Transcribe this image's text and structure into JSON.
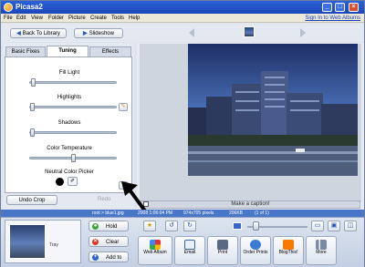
{
  "window": {
    "title": "Picasa2"
  },
  "menu": [
    "File",
    "Edit",
    "View",
    "Folder",
    "Picture",
    "Create",
    "Tools",
    "Help"
  ],
  "sign_in_link": "Sign In to Web Albums",
  "top_buttons": {
    "back": "Back To Library",
    "slideshow": "Slideshow"
  },
  "tabs": [
    {
      "label": "Basic Fixes",
      "active": false
    },
    {
      "label": "Tuning",
      "active": true
    },
    {
      "label": "Effects",
      "active": false
    }
  ],
  "tuning": {
    "fill_light": {
      "label": "Fill Light",
      "level": 0.03
    },
    "highlights": {
      "label": "Highlights",
      "level": 0.02
    },
    "shadows": {
      "label": "Shadows",
      "level": 0.02
    },
    "color_temperature": {
      "label": "Color Temperature",
      "level": 0.5
    },
    "neutral_picker": {
      "label": "Neutral Color Picker"
    }
  },
  "undo_label": "Undo Crop",
  "redo_label": "Redo",
  "caption_placeholder": "Make a caption!",
  "status": {
    "path": "root > blue1.jpg",
    "date": "2008 1:06:04 PM",
    "size": "974x705 pixels",
    "filesize": "206KB",
    "count": "(1 of 1)"
  },
  "tray": {
    "label": "Tray",
    "hold": "Hold",
    "clear": "Clear",
    "add_to": "Add to"
  },
  "actions": [
    "Web Album",
    "Email",
    "Print",
    "Order Prints",
    "BlogThis!",
    "More"
  ],
  "colors": {
    "titlebar": "#1b46b8",
    "status": "#4a76c8",
    "hold_green": "#3aa33a",
    "clear_red": "#d23a2a",
    "addto_blue": "#2f5fc8"
  }
}
